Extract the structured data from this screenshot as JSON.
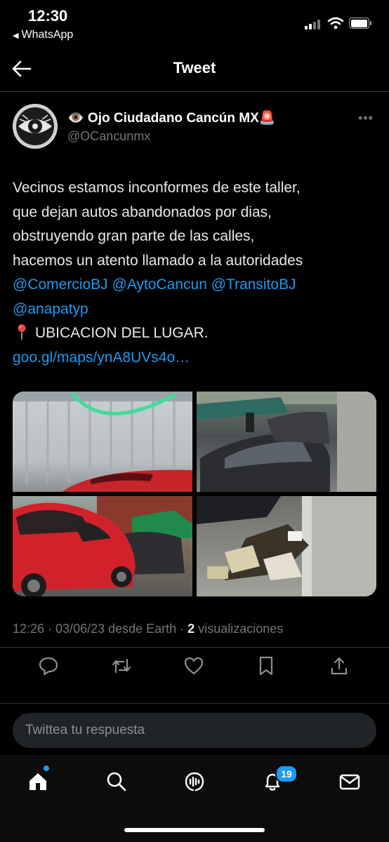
{
  "status_bar": {
    "time": "12:30",
    "back_app": "WhatsApp"
  },
  "header": {
    "title": "Tweet"
  },
  "tweet": {
    "author_name": "👁️ Ojo Ciudadano Cancún MX🚨",
    "author_handle": "@OCancunmx",
    "text_lines": [
      "Vecinos estamos inconformes de este taller,",
      "que dejan autos abandonados por dias,",
      "obstruyendo gran parte de las calles,",
      "hacemos un atento llamado a la autoridades"
    ],
    "mentions": [
      "@ComercioBJ",
      "@AytoCancun",
      "@TransitoBJ",
      "@anapatyp"
    ],
    "location_line": "📍 UBICACION DEL LUGAR.",
    "link": "goo.gl/maps/ynA8UVs4o…",
    "timestamp": "12:26 · 03/06/23 desde Earth · ",
    "views_count": "2",
    "views_label": " visualizaciones"
  },
  "actions": [
    "reply-icon",
    "retweet-icon",
    "like-icon",
    "bookmark-icon",
    "share-icon"
  ],
  "reply": {
    "placeholder": "Twittea tu respuesta"
  },
  "tabbar": {
    "items": [
      "home-icon",
      "search-icon",
      "spaces-icon",
      "notifications-icon",
      "messages-icon"
    ],
    "notifications_badge": "19"
  },
  "colors": {
    "accent": "#1d9bf0",
    "background": "#000000",
    "muted": "#71767b"
  }
}
